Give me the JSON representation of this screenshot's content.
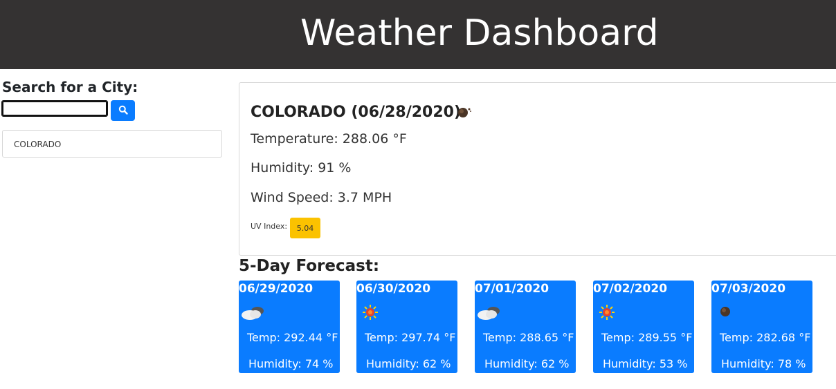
{
  "header": {
    "title": "Weather Dashboard"
  },
  "search": {
    "label": "Search for a City:",
    "input_value": "",
    "button_icon": "search-icon"
  },
  "history": {
    "items": [
      "COLORADO"
    ]
  },
  "current": {
    "title": "COLORADO (06/28/2020)",
    "icon": "brown-orb-icon",
    "temperature": "Temperature: 288.06 °F",
    "humidity": "Humidity: 91 %",
    "wind": "Wind Speed: 3.7 MPH",
    "uv_label": "UV Index:",
    "uv_value": "5.04",
    "uv_color": "#fbc200"
  },
  "forecast": {
    "heading": "5-Day Forecast:",
    "card_color": "#0a7cff",
    "days": [
      {
        "date": "06/29/2020",
        "icon": "cloud-icon",
        "temp": "Temp: 292.44 °F",
        "humidity": "Humidity: 74 %"
      },
      {
        "date": "06/30/2020",
        "icon": "sun-icon",
        "temp": "Temp: 297.74 °F",
        "humidity": "Humidity: 62 %"
      },
      {
        "date": "07/01/2020",
        "icon": "cloud-icon",
        "temp": "Temp: 288.65 °F",
        "humidity": "Humidity: 62 %"
      },
      {
        "date": "07/02/2020",
        "icon": "sun-icon",
        "temp": "Temp: 289.55 °F",
        "humidity": "Humidity: 53 %"
      },
      {
        "date": "07/03/2020",
        "icon": "brown-orb-icon",
        "temp": "Temp: 282.68 °F",
        "humidity": "Humidity: 78 %"
      }
    ]
  }
}
